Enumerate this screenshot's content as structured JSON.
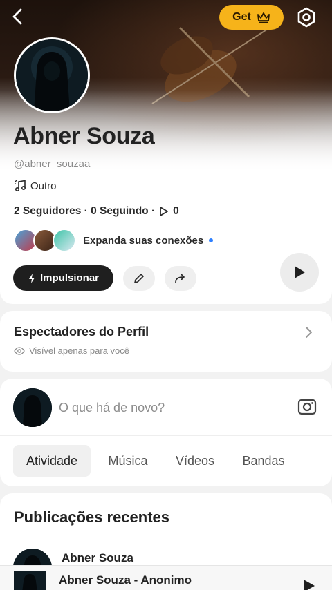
{
  "header": {
    "get_label": "Get"
  },
  "profile": {
    "name": "Abner Souza",
    "handle": "@abner_souzaa",
    "genre": "Outro",
    "stats": "2 Seguidores · 0 Seguindo · ",
    "plays": "0",
    "connections_label": "Expanda suas conexões",
    "boost_label": "Impulsionar"
  },
  "viewers": {
    "title": "Espectadores do Perfil",
    "subtitle": "Visível apenas para você"
  },
  "composer": {
    "placeholder": "O que há de novo?"
  },
  "tabs": [
    {
      "label": "Atividade"
    },
    {
      "label": "Música"
    },
    {
      "label": "Vídeos"
    },
    {
      "label": "Bandas"
    }
  ],
  "recent": {
    "title": "Publicações recentes",
    "post_author": "Abner Souza"
  },
  "player": {
    "title": "Abner Souza - Anonimo"
  },
  "colors": {
    "accent": "#f6b31a",
    "dark_button": "#1f1f1f",
    "dot": "#2f80ff"
  }
}
